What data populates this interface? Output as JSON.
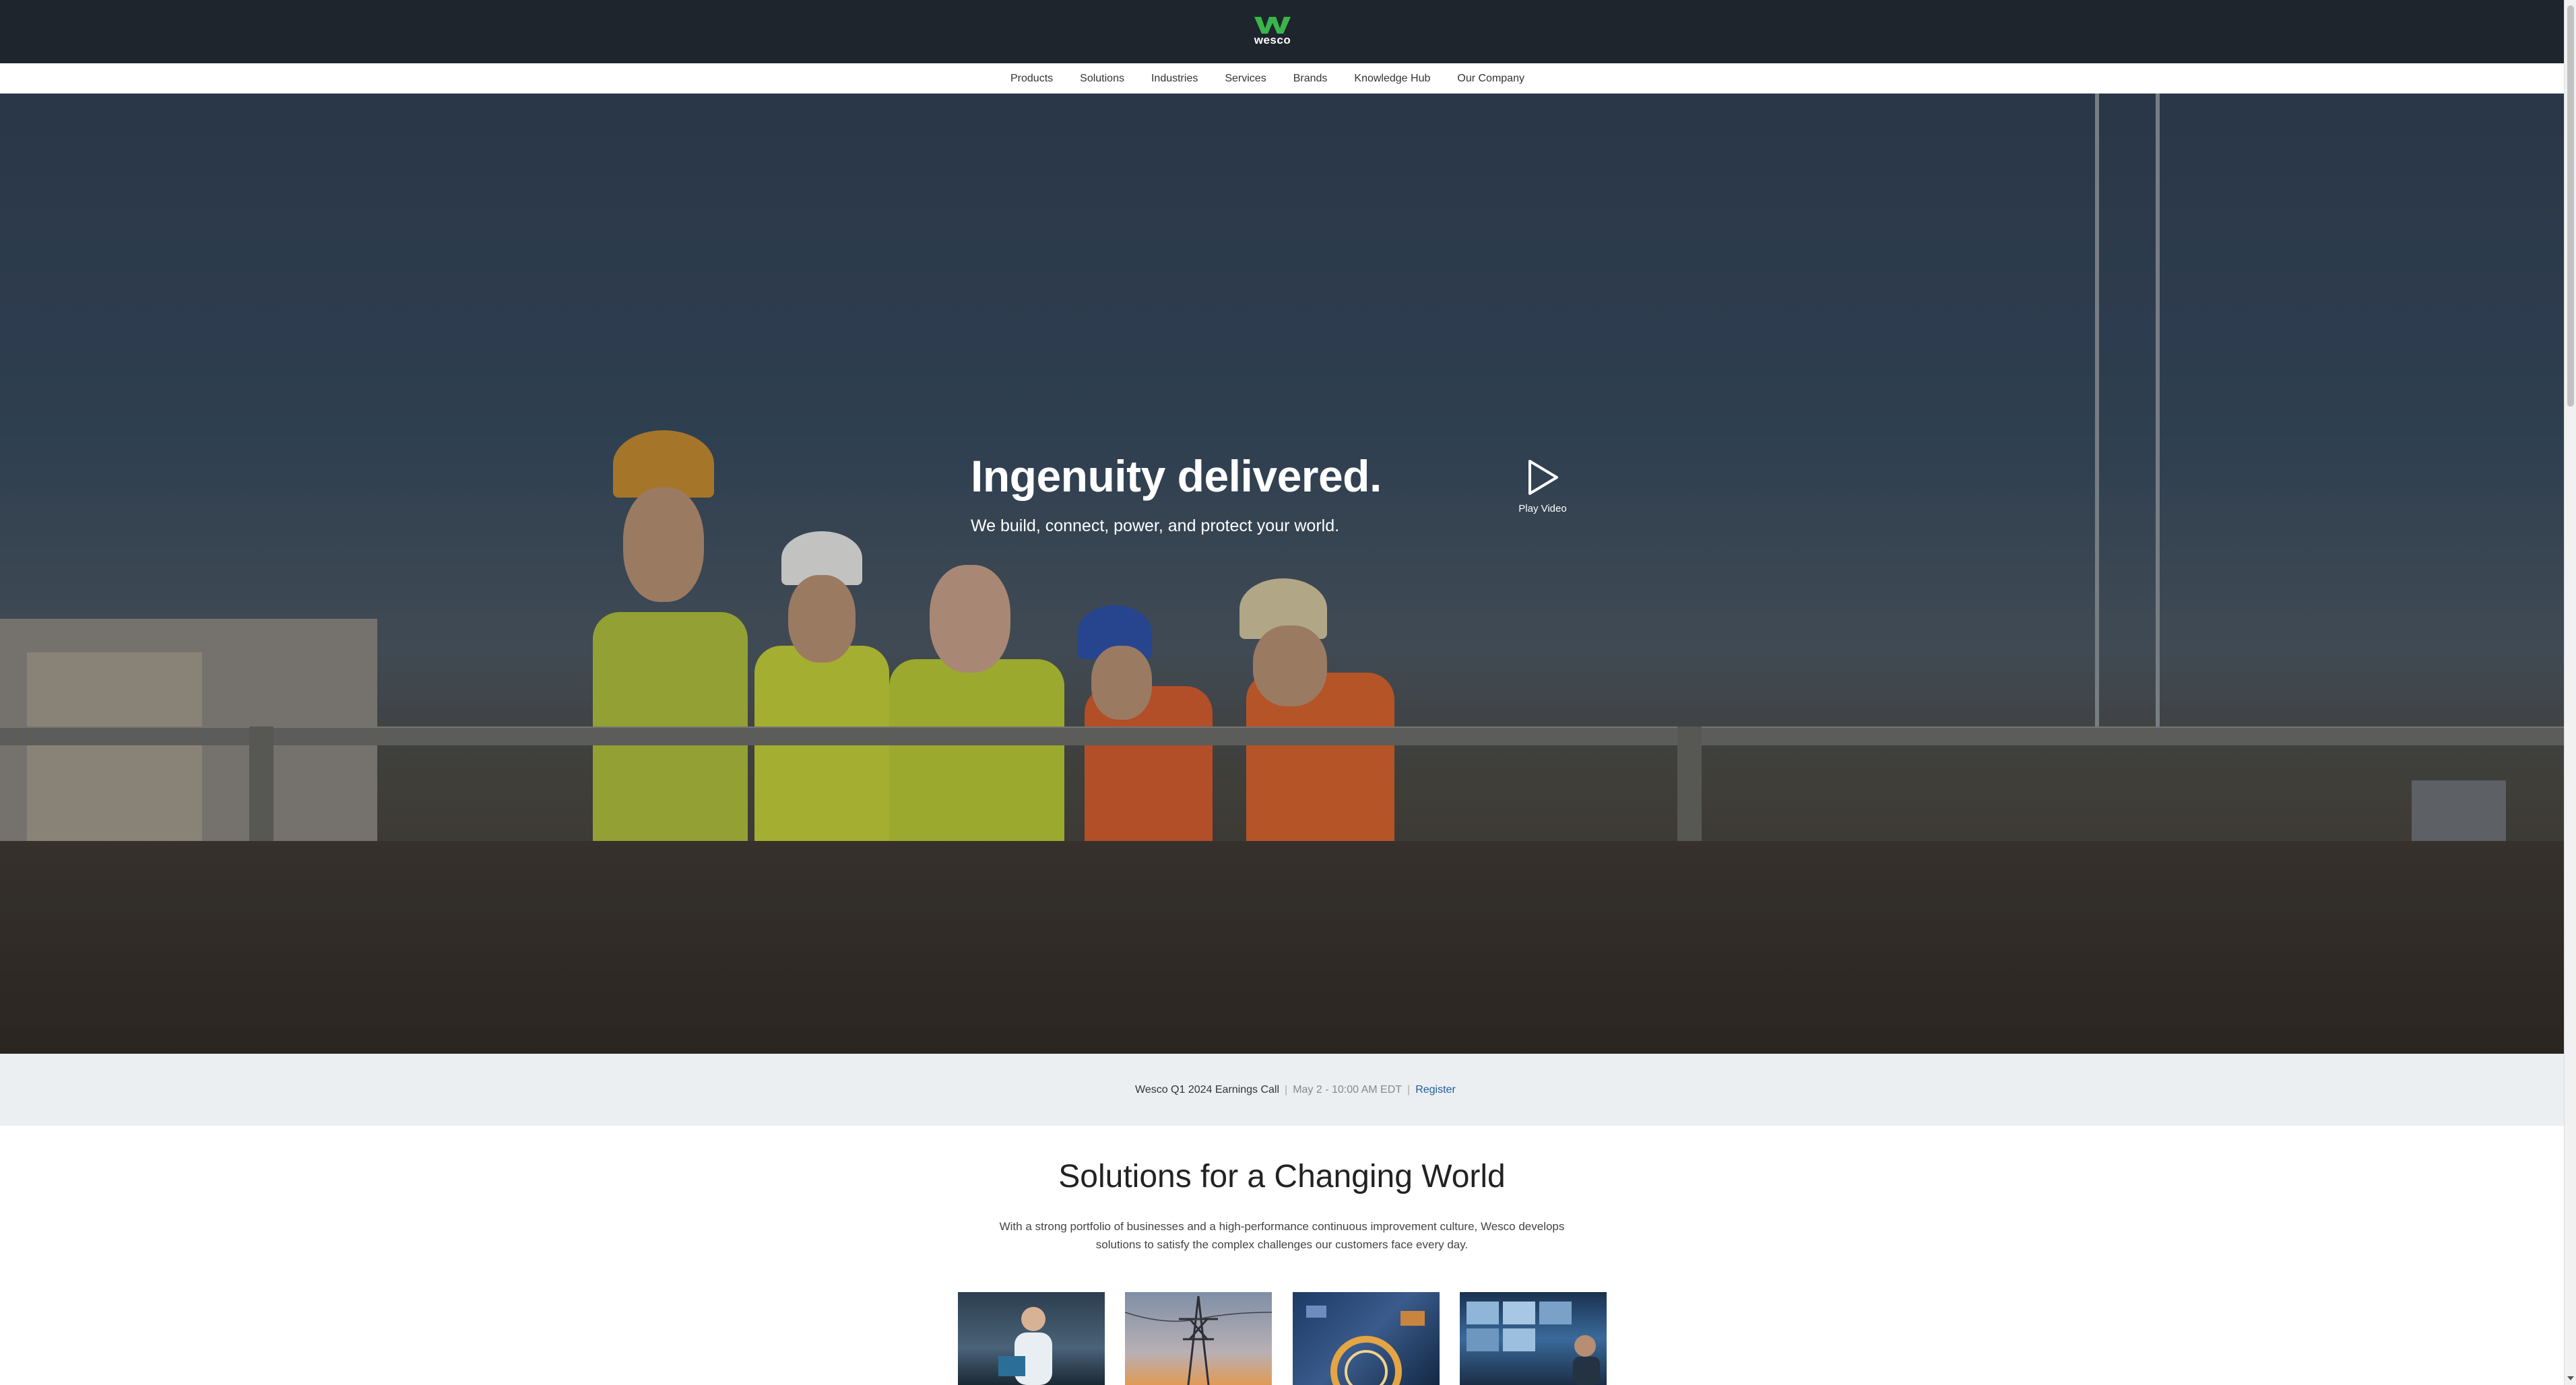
{
  "brand": {
    "logo_text": "wesco",
    "logo_color": "#3ab54a"
  },
  "nav": {
    "items": [
      {
        "label": "Products"
      },
      {
        "label": "Solutions"
      },
      {
        "label": "Industries"
      },
      {
        "label": "Services"
      },
      {
        "label": "Brands"
      },
      {
        "label": "Knowledge Hub"
      },
      {
        "label": "Our Company"
      }
    ]
  },
  "hero": {
    "title": "Ingenuity delivered.",
    "subtitle": "We build, connect, power, and protect your world.",
    "play_label": "Play Video"
  },
  "announcement": {
    "title": "Wesco Q1 2024 Earnings Call",
    "date": "May 2 - 10:00 AM EDT",
    "link": "Register",
    "link_color": "#1f5a96"
  },
  "solutions": {
    "title": "Solutions for a Changing World",
    "description": "With a strong portfolio of businesses and a high-performance continuous improvement culture, Wesco develops solutions to satisfy the complex challenges our customers face every day.",
    "tiles": [
      {
        "icon": "engineer-photo"
      },
      {
        "icon": "power-tower-photo"
      },
      {
        "icon": "circuit-ring-photo"
      },
      {
        "icon": "security-monitors-photo"
      }
    ]
  },
  "colors": {
    "header_bg": "#1e252c",
    "announce_bg": "#ebeff2"
  }
}
